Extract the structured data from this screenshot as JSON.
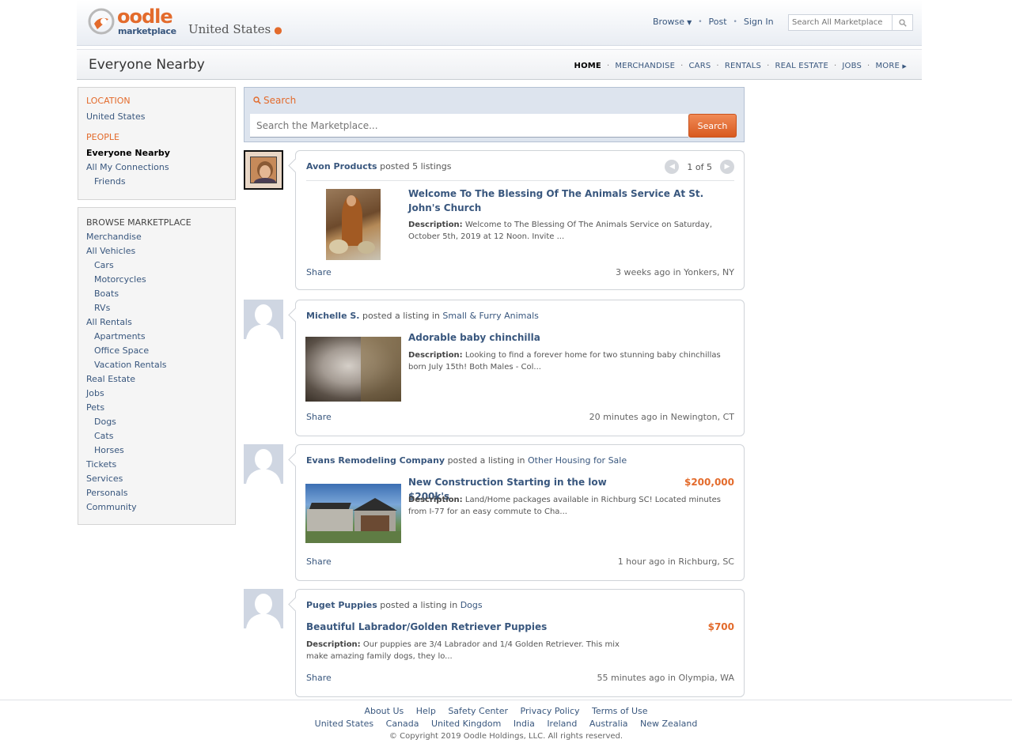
{
  "header": {
    "logo_word": "oodle",
    "logo_sub": "marketplace",
    "region": "United States",
    "nav": {
      "browse": "Browse",
      "post": "Post",
      "signin": "Sign In"
    },
    "search_placeholder": "Search All Marketplace"
  },
  "subheader": {
    "title": "Everyone Nearby",
    "categories": [
      "HOME",
      "MERCHANDISE",
      "CARS",
      "RENTALS",
      "REAL ESTATE",
      "JOBS",
      "MORE"
    ]
  },
  "sidebar": {
    "location_heading": "LOCATION",
    "location_value": "United States",
    "people_heading": "PEOPLE",
    "people": [
      "Everyone Nearby",
      "All My Connections",
      "Friends"
    ],
    "browse_heading": "BROWSE MARKETPLACE",
    "browse": [
      "Merchandise",
      "All Vehicles",
      "Cars",
      "Motorcycles",
      "Boats",
      "RVs",
      "All Rentals",
      "Apartments",
      "Office Space",
      "Vacation Rentals",
      "Real Estate",
      "Jobs",
      "Pets",
      "Dogs",
      "Cats",
      "Horses",
      "Tickets",
      "Services",
      "Personals",
      "Community"
    ]
  },
  "search": {
    "label": "Search",
    "placeholder": "Search the Marketplace...",
    "button": "Search"
  },
  "feed": [
    {
      "poster": "Avon Products",
      "action": "posted 5 listings",
      "category": "",
      "pager": "1 of 5",
      "title": "Welcome To The Blessing Of The Animals Service At St. John's Church",
      "price": "",
      "desc_label": "Description:",
      "desc": "Welcome to The Blessing Of The Animals Service on Saturday, October 5th, 2019 at 12 Noon. Invite ...",
      "share": "Share",
      "when": "3 weeks ago in Yonkers, NY"
    },
    {
      "poster": "Michelle S.",
      "action": "posted a listing in",
      "category": "Small & Furry Animals",
      "title": "Adorable baby chinchilla",
      "price": "",
      "desc_label": "Description:",
      "desc": "Looking to find a forever home for two stunning baby chinchillas born July 15th! Both Males - Col...",
      "share": "Share",
      "when": "20 minutes ago in Newington, CT"
    },
    {
      "poster": "Evans Remodeling Company",
      "action": "posted a listing in",
      "category": "Other Housing for Sale",
      "title": "New Construction Starting in the low $200k's",
      "price": "$200,000",
      "desc_label": "Description:",
      "desc": "Land/Home packages available in Richburg SC! Located minutes from I-77 for an easy commute to Cha...",
      "share": "Share",
      "when": "1 hour ago in Richburg, SC"
    },
    {
      "poster": "Puget Puppies",
      "action": "posted a listing in",
      "category": "Dogs",
      "title": "Beautiful Labrador/Golden Retriever Puppies",
      "price": "$700",
      "desc_label": "Description:",
      "desc": "Our puppies are 3/4 Labrador and 1/4 Golden Retriever. This mix make amazing family dogs, they lo...",
      "share": "Share",
      "when": "55 minutes ago in Olympia, WA"
    }
  ],
  "footer": {
    "links": [
      "About Us",
      "Help",
      "Safety Center",
      "Privacy Policy",
      "Terms of Use"
    ],
    "countries": [
      "United States",
      "Canada",
      "United Kingdom",
      "India",
      "Ireland",
      "Australia",
      "New Zealand"
    ],
    "copyright": "© Copyright 2019 Oodle Holdings, LLC. All rights reserved."
  },
  "colors": {
    "accent": "#e36b2c",
    "link": "#39577e",
    "search_panel": "#dde4ee"
  },
  "icons": [
    "oodle-logo-icon",
    "location-pin-icon",
    "caret-down-icon",
    "magnifier-icon",
    "prev-arrow-icon",
    "next-arrow-icon",
    "default-avatar-icon"
  ]
}
